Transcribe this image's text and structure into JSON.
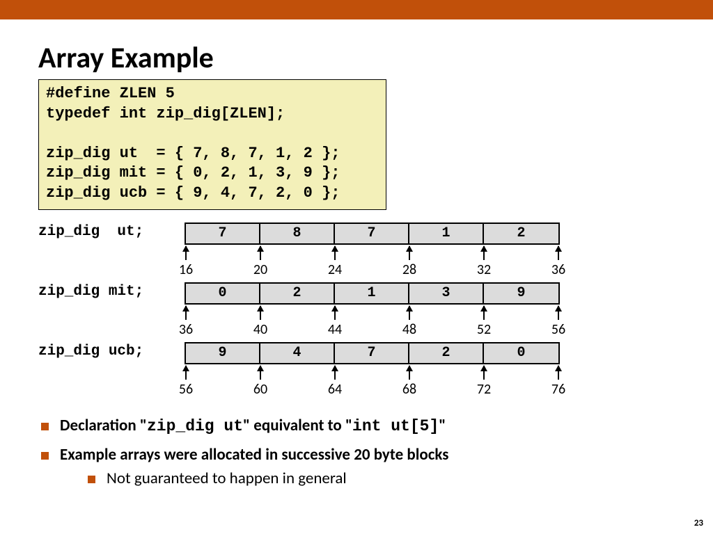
{
  "title": "Array Example",
  "code": "#define ZLEN 5\ntypedef int zip_dig[ZLEN];\n\nzip_dig ut  = { 7, 8, 7, 1, 2 };\nzip_dig mit = { 0, 2, 1, 3, 9 };\nzip_dig ucb = { 9, 4, 7, 2, 0 };",
  "arrays": [
    {
      "label": "zip_dig  ut;",
      "cells": [
        "7",
        "8",
        "7",
        "1",
        "2"
      ],
      "addrs": [
        "16",
        "20",
        "24",
        "28",
        "32",
        "36"
      ]
    },
    {
      "label": "zip_dig mit;",
      "cells": [
        "0",
        "2",
        "1",
        "3",
        "9"
      ],
      "addrs": [
        "36",
        "40",
        "44",
        "48",
        "52",
        "56"
      ]
    },
    {
      "label": "zip_dig ucb;",
      "cells": [
        "9",
        "4",
        "7",
        "2",
        "0"
      ],
      "addrs": [
        "56",
        "60",
        "64",
        "68",
        "72",
        "76"
      ]
    }
  ],
  "bullets": {
    "b1a_pre": "Declaration \"",
    "b1a_code1": "zip_dig ut",
    "b1a_mid": "\" equivalent to \"",
    "b1a_code2": "int ut[5]",
    "b1a_post": "\"",
    "b2": "Example arrays were allocated in successive 20 byte blocks",
    "b2sub": "Not guaranteed to happen in general"
  },
  "page": "23"
}
